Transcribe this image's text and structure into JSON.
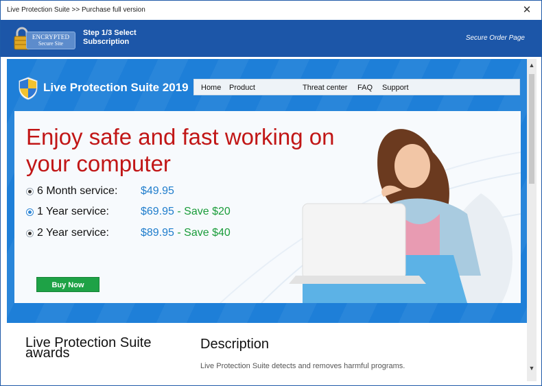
{
  "window": {
    "title": "Live Protection Suite >> Purchase full version",
    "close_glyph": "✕"
  },
  "order_bar": {
    "badge_line1": "ENCRYPTED",
    "badge_line2": "Secure Site",
    "step_text": "Step 1/3 Select Subscription",
    "secure_text": "Secure Order Page"
  },
  "site": {
    "brand": "Live Protection Suite 2019",
    "nav": [
      "Home",
      "Product",
      "Threat center",
      "FAQ",
      "Support"
    ]
  },
  "hero": {
    "headline": "Enjoy safe and fast working on your computer",
    "options": [
      {
        "label": "6 Month service:",
        "price": "$49.95",
        "save": "",
        "selected": false
      },
      {
        "label": "1 Year service:",
        "price": "$69.95",
        "save": "- Save $20",
        "selected": true
      },
      {
        "label": "2 Year service:",
        "price": "$89.95",
        "save": "- Save $40",
        "selected": false
      }
    ],
    "buy_label": "Buy Now"
  },
  "lower": {
    "awards_title": "Live Protection Suite awards",
    "desc_title": "Description",
    "desc_text": "Live Protection Suite detects and removes harmful programs."
  },
  "scrollbar": {
    "up_glyph": "▲",
    "down_glyph": "▼"
  },
  "colors": {
    "order_bar": "#1c56a8",
    "site_blue": "#1e7fd8",
    "headline_red": "#c11616",
    "price_blue": "#1f7dcc",
    "save_green": "#1a9c3a",
    "buy_green": "#1ea246"
  },
  "icons": {
    "lock": "padlock-icon",
    "shield": "shield-icon",
    "close": "close-icon"
  }
}
